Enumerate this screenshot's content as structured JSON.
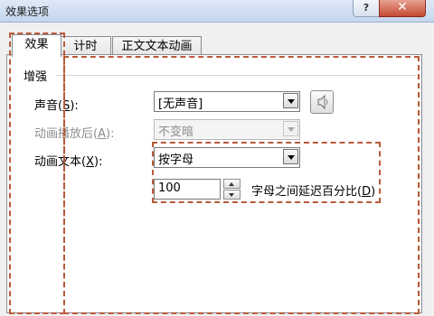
{
  "window": {
    "title": "效果选项",
    "help_label": "?",
    "close_label": "✕"
  },
  "tabs": [
    {
      "label": "效果",
      "active": true
    },
    {
      "label": "计时",
      "active": false
    },
    {
      "label": "正文文本动画",
      "active": false
    }
  ],
  "enhance": {
    "group_label": "增强",
    "sound": {
      "label": "声音",
      "hotkey": "S",
      "value": "[无声音]"
    },
    "after_animation": {
      "label": "动画播放后",
      "hotkey": "A",
      "value": "不变暗",
      "disabled": true
    },
    "animate_text": {
      "label": "动画文本",
      "hotkey": "X",
      "value": "按字母"
    },
    "delay": {
      "value": "100",
      "caption": "字母之间延迟百分比",
      "hotkey": "D"
    }
  },
  "colors": {
    "annotation_dash": "#b75a3a",
    "titlebar": "#dfe9f6",
    "close_button": "#c44a34"
  },
  "icons": {
    "sound_preview": "speaker-icon"
  }
}
